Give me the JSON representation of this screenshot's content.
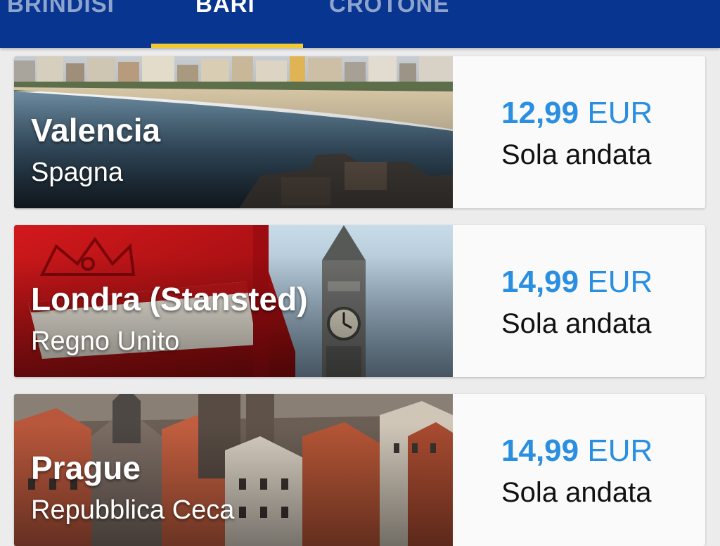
{
  "tabs": [
    {
      "label": "BRINDISI",
      "selected": false
    },
    {
      "label": "BARI",
      "selected": true
    },
    {
      "label": "CROTONE",
      "selected": false
    }
  ],
  "colors": {
    "header": "#073590",
    "indicator": "#f1c933",
    "price": "#2a8fe0",
    "background": "#ececec"
  },
  "destinations": [
    {
      "city": "Valencia",
      "country": "Spagna",
      "amount": "12,99",
      "currency": "EUR",
      "trip_type": "Sola andata",
      "image": "beach-skyline-image"
    },
    {
      "city": "Londra (Stansted)",
      "country": "Regno Unito",
      "amount": "14,99",
      "currency": "EUR",
      "trip_type": "Sola andata",
      "image": "phone-box-big-ben-image"
    },
    {
      "city": "Prague",
      "country": "Repubblica Ceca",
      "amount": "14,99",
      "currency": "EUR",
      "trip_type": "Sola andata",
      "image": "prague-old-town-image"
    }
  ]
}
